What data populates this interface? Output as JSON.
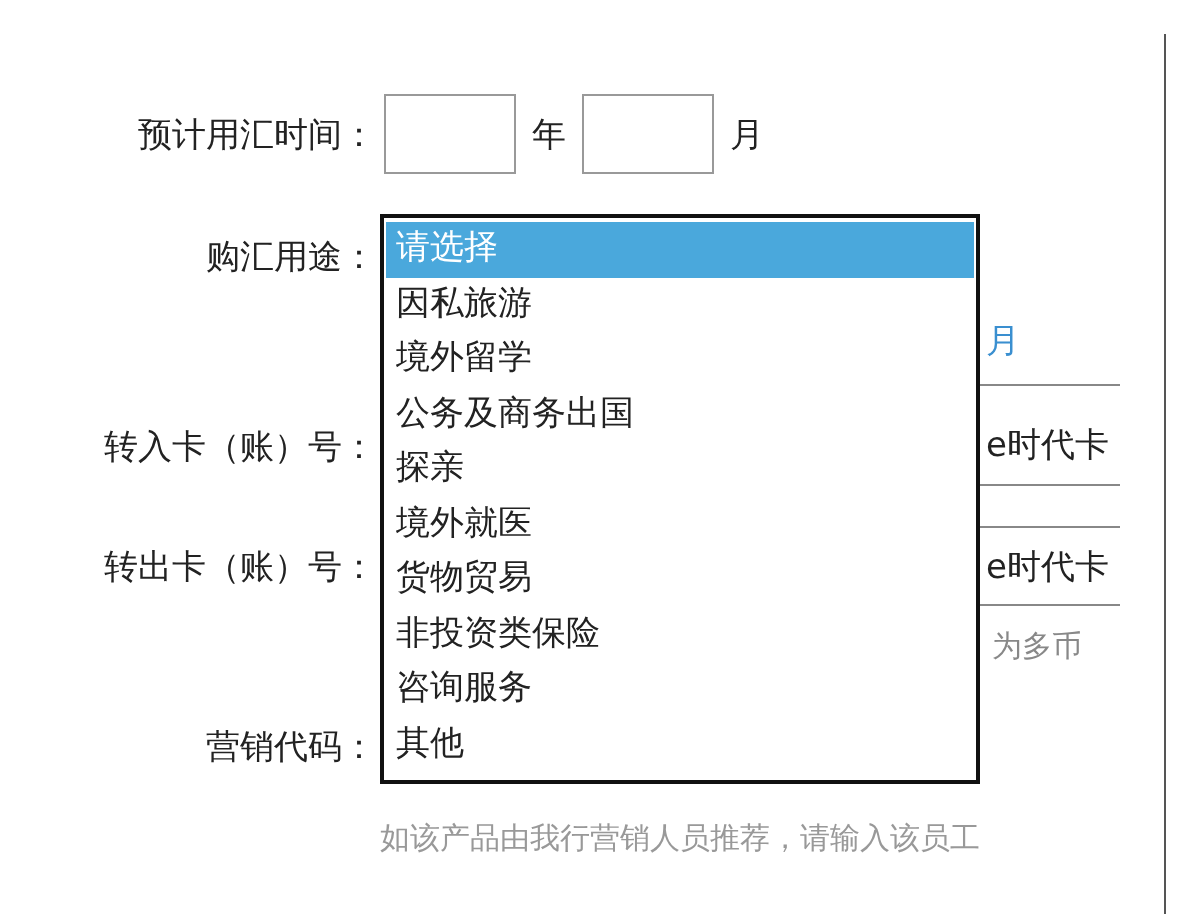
{
  "expected_time": {
    "label": "预计用汇时间：",
    "year_unit": "年",
    "month_unit": "月"
  },
  "purpose": {
    "label": "购汇用途：",
    "note": "月",
    "options": [
      {
        "text": "请选择",
        "selected": true
      },
      {
        "text": "因私旅游",
        "selected": false
      },
      {
        "text": "境外留学",
        "selected": false
      },
      {
        "text": "公务及商务出国",
        "selected": false
      },
      {
        "text": "探亲",
        "selected": false
      },
      {
        "text": "境外就医",
        "selected": false
      },
      {
        "text": "货物贸易",
        "selected": false
      },
      {
        "text": "非投资类保险",
        "selected": false
      },
      {
        "text": "咨询服务",
        "selected": false
      },
      {
        "text": "其他",
        "selected": false
      }
    ]
  },
  "transfer_in": {
    "label": "转入卡（账）号：",
    "value": "e时代卡"
  },
  "transfer_out": {
    "label": "转出卡（账）号：",
    "value": "e时代卡",
    "note": "为多币"
  },
  "marketing_code": {
    "label": "营销代码：",
    "hint": "如该产品由我行营销人员推荐，请输入该员工"
  }
}
